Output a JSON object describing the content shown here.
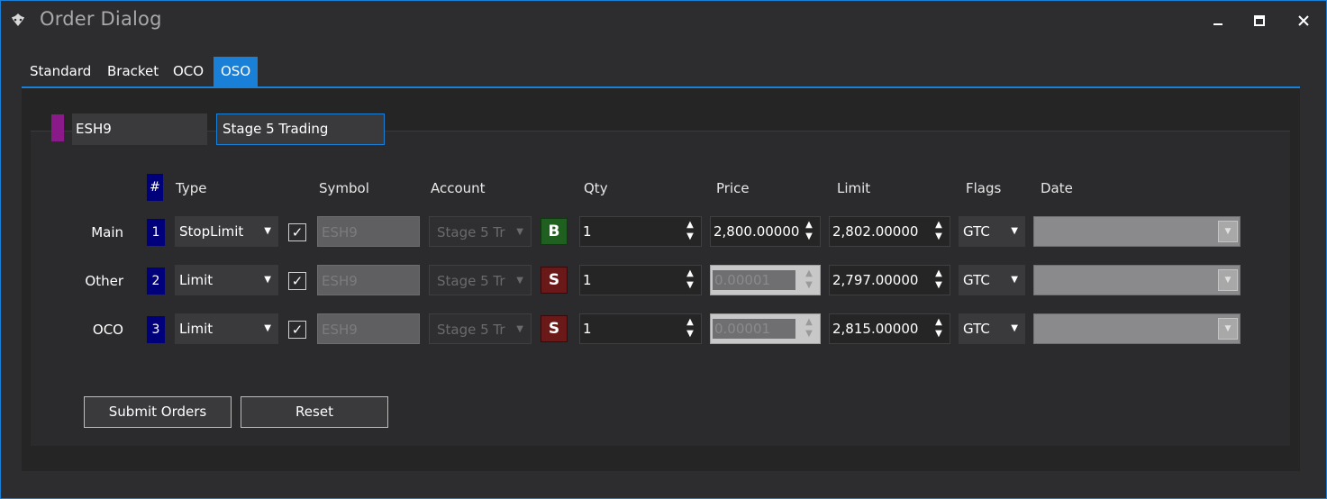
{
  "window": {
    "title": "Order Dialog"
  },
  "window_controls": {
    "minimize": "▁",
    "maximize": "□",
    "close": "✕"
  },
  "tabs": [
    {
      "label": "Standard",
      "active": false
    },
    {
      "label": "Bracket",
      "active": false
    },
    {
      "label": "OCO",
      "active": false
    },
    {
      "label": "OSO",
      "active": true
    }
  ],
  "header_fields": {
    "symbol": "ESH9",
    "account": "Stage 5 Trading",
    "color": "#8a1a8a"
  },
  "columns": {
    "num": "#",
    "type": "Type",
    "symbol": "Symbol",
    "account": "Account",
    "qty": "Qty",
    "price": "Price",
    "limit": "Limit",
    "flags": "Flags",
    "date": "Date"
  },
  "rows": [
    {
      "label": "Main",
      "num": "1",
      "type": "StopLimit",
      "checked": "✓",
      "symbol": "ESH9",
      "account": "Stage 5 Tr",
      "side": "B",
      "qty": "1",
      "price": "2,800.00000",
      "price_disabled": false,
      "limit": "2,802.00000",
      "flags": "GTC",
      "date": ""
    },
    {
      "label": "Other",
      "num": "2",
      "type": "Limit",
      "checked": "✓",
      "symbol": "ESH9",
      "account": "Stage 5 Tr",
      "side": "S",
      "qty": "1",
      "price": "0.00001",
      "price_disabled": true,
      "limit": "2,797.00000",
      "flags": "GTC",
      "date": ""
    },
    {
      "label": "OCO",
      "num": "3",
      "type": "Limit",
      "checked": "✓",
      "symbol": "ESH9",
      "account": "Stage 5 Tr",
      "side": "S",
      "qty": "1",
      "price": "0.00001",
      "price_disabled": true,
      "limit": "2,815.00000",
      "flags": "GTC",
      "date": ""
    }
  ],
  "buttons": {
    "submit": "Submit Orders",
    "reset": "Reset"
  },
  "colors": {
    "accent": "#1a7fd6",
    "buy": "#1f5f1f",
    "sell": "#6a1818",
    "row_number_bg": "#00007a"
  }
}
